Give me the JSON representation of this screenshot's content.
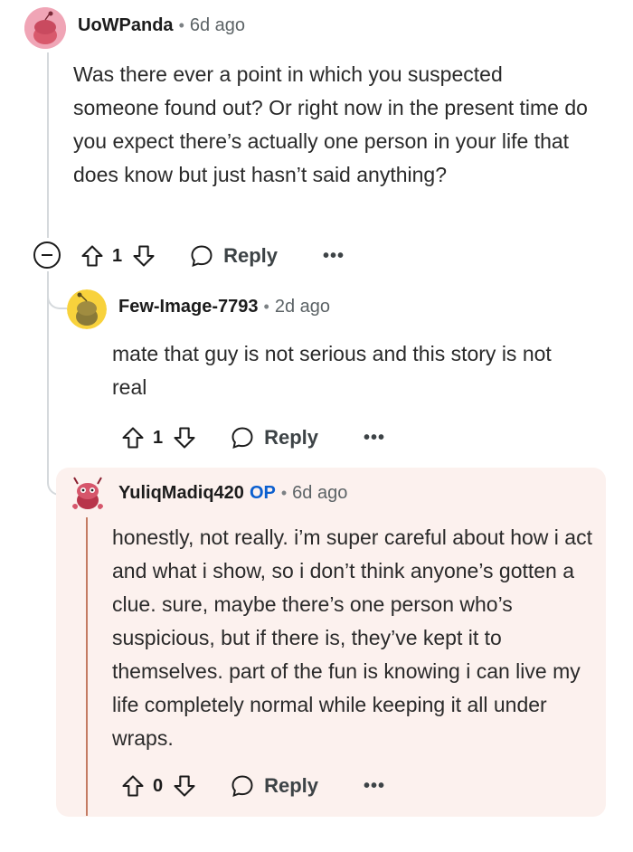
{
  "comments": [
    {
      "username": "UoWPanda",
      "separator": "•",
      "time": "6d ago",
      "body": "Was there ever a point in which you suspected someone found out? Or right now in the present time do you expect there’s actually one person in your life that does know but just hasn’t said anything?",
      "votes": "1",
      "reply_label": "Reply",
      "more_label": "•••",
      "avatar_icon": "snoo-avatar-pink"
    },
    {
      "username": "Few-Image-7793",
      "separator": "•",
      "time": "2d ago",
      "body": "mate that guy is not serious and this story is not real",
      "votes": "1",
      "reply_label": "Reply",
      "more_label": "•••",
      "avatar_icon": "snoo-avatar-yellow"
    },
    {
      "username": "YuliqMadiq420",
      "op_badge": "OP",
      "separator": "•",
      "time": "6d ago",
      "body": "honestly, not really. i’m super careful about how i act and what i show, so i don’t think anyone’s gotten a clue. sure, maybe there’s one person who’s suspicious, but if there is, they’ve kept it to themselves. part of the fun is knowing i can live my life completely normal while keeping it all under wraps.",
      "votes": "0",
      "reply_label": "Reply",
      "more_label": "•••",
      "avatar_icon": "snoo-avatar-red"
    }
  ],
  "colors": {
    "op_highlight": "#fcf1ee",
    "op_badge": "#0b5fcf",
    "thread_line": "#d5d9dc"
  }
}
